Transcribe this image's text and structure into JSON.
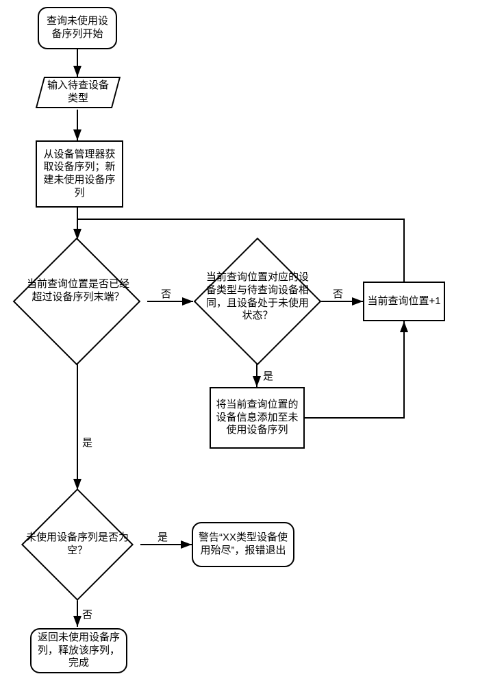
{
  "chart_data": {
    "type": "flowchart",
    "title": "",
    "nodes": [
      {
        "id": "start",
        "shape": "terminator",
        "text": "查询未使用设备序列开始"
      },
      {
        "id": "input",
        "shape": "parallelogram",
        "text": "输入待查设备类型"
      },
      {
        "id": "init",
        "shape": "process",
        "text": "从设备管理器获取设备序列；新建未使用设备序列"
      },
      {
        "id": "d1",
        "shape": "decision",
        "text": "当前查询位置是否已经超过设备序列末端？"
      },
      {
        "id": "d2",
        "shape": "decision",
        "text": "当前查询位置对应的设备类型与待查询设备相同，且设备处于未使用状态？"
      },
      {
        "id": "incr",
        "shape": "process",
        "text": "当前查询位置+1"
      },
      {
        "id": "append",
        "shape": "process",
        "text": "将当前查询位置的设备信息添加至未使用设备序列"
      },
      {
        "id": "d3",
        "shape": "decision",
        "text": "未使用设备序列是否为空？"
      },
      {
        "id": "warn",
        "shape": "terminator",
        "text": "警告“XX类型设备使用殆尽”，报错退出"
      },
      {
        "id": "done",
        "shape": "terminator",
        "text": "返回未使用设备序列，释放该序列，完成"
      }
    ],
    "edges": [
      {
        "from": "start",
        "to": "input",
        "label": ""
      },
      {
        "from": "input",
        "to": "init",
        "label": ""
      },
      {
        "from": "init",
        "to": "d1",
        "label": ""
      },
      {
        "from": "d1",
        "to": "d2",
        "label": "否"
      },
      {
        "from": "d1",
        "to": "d3",
        "label": "是"
      },
      {
        "from": "d2",
        "to": "incr",
        "label": "否"
      },
      {
        "from": "d2",
        "to": "append",
        "label": "是"
      },
      {
        "from": "incr",
        "to": "d1",
        "label": ""
      },
      {
        "from": "append",
        "to": "incr",
        "label": ""
      },
      {
        "from": "d3",
        "to": "warn",
        "label": "是"
      },
      {
        "from": "d3",
        "to": "done",
        "label": "否"
      }
    ],
    "edge_labels": {
      "yes": "是",
      "no": "否"
    }
  }
}
